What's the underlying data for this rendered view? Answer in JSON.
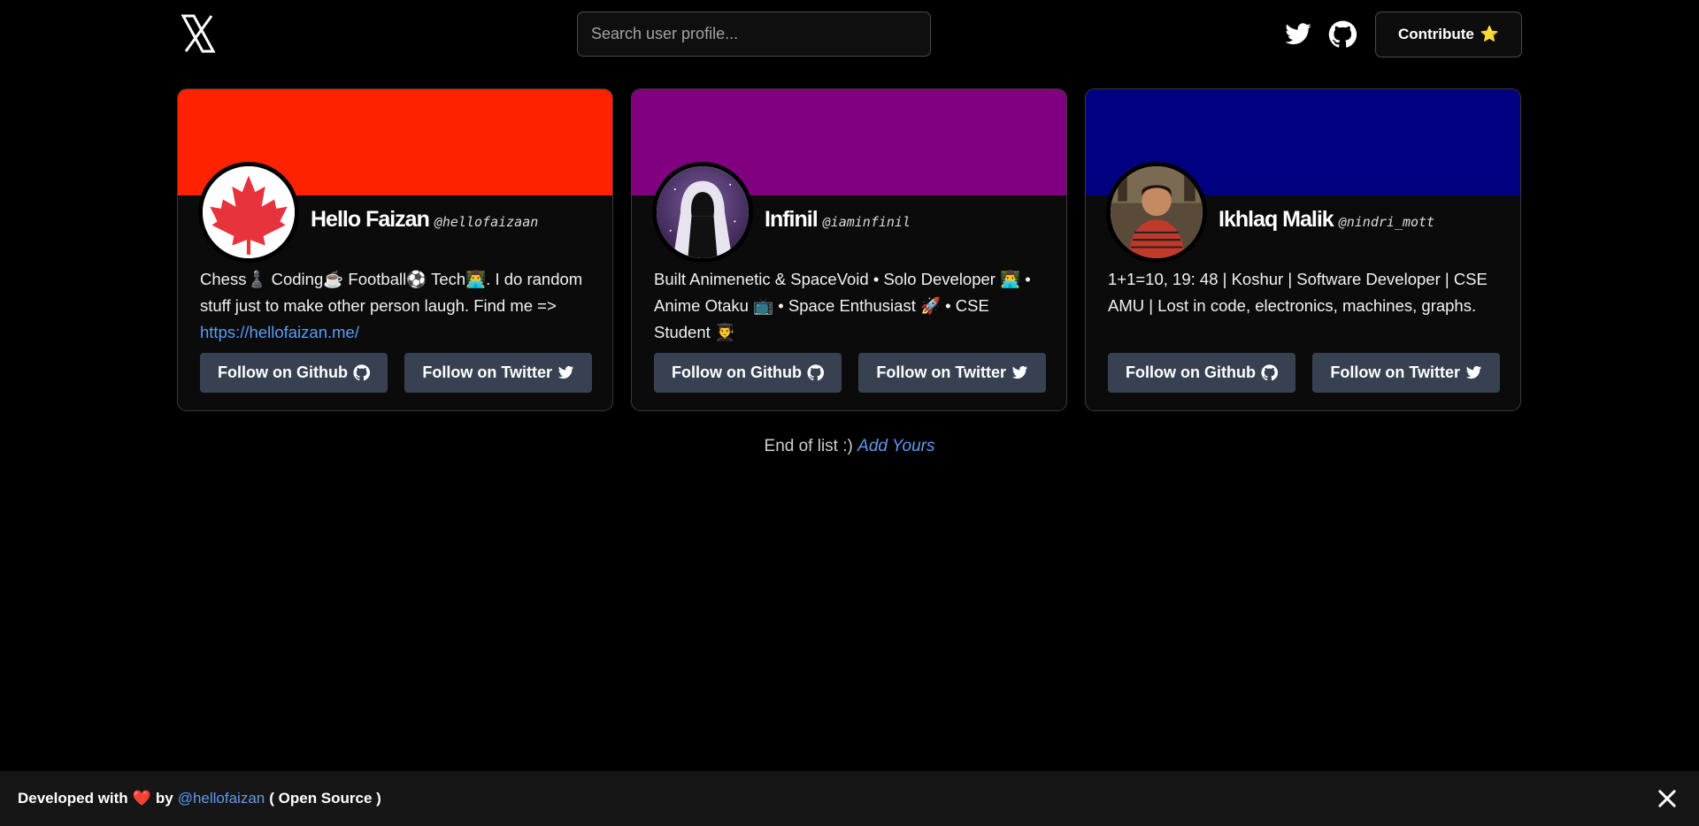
{
  "header": {
    "logo_icon": "x-logo-icon",
    "search_placeholder": "Search user profile...",
    "contribute_label": "Contribute",
    "contribute_emoji": "⭐"
  },
  "cards": [
    {
      "banner_color": "#ff2200",
      "name": "Hello Faizan",
      "handle": "@hellofaizaan",
      "bio_text": "Chess♟️ Coding☕ Football⚽ Tech👨‍💻. I do random stuff just to make other person laugh. Find me =>",
      "bio_link": "https://hellofaizan.me/",
      "github_label": "Follow on Github",
      "twitter_label": "Follow on Twitter"
    },
    {
      "banner_color": "#800080",
      "name": "Infinil",
      "handle": "@iaminfinil",
      "bio_text": "Built Animenetic & SpaceVoid • Solo Developer 👨‍💻 • Anime Otaku 📺 • Space Enthusiast 🚀 • CSE Student 👨‍🎓",
      "github_label": "Follow on Github",
      "twitter_label": "Follow on Twitter"
    },
    {
      "banner_color": "#000080",
      "name": "Ikhlaq Malik",
      "handle": "@nindri_mott",
      "bio_text": "1+1=10, 19: 48 | Koshur | Software Developer | CSE AMU | Lost in code, electronics, machines, graphs.",
      "github_label": "Follow on Github",
      "twitter_label": "Follow on Twitter"
    }
  ],
  "end_of_list": {
    "text": "End of list :)",
    "link": "Add Yours"
  },
  "footer": {
    "developed_with": "Developed with",
    "heart": "❤️",
    "by": "by",
    "author_link": "@hellofaizan",
    "open_source": "( Open Source )"
  }
}
